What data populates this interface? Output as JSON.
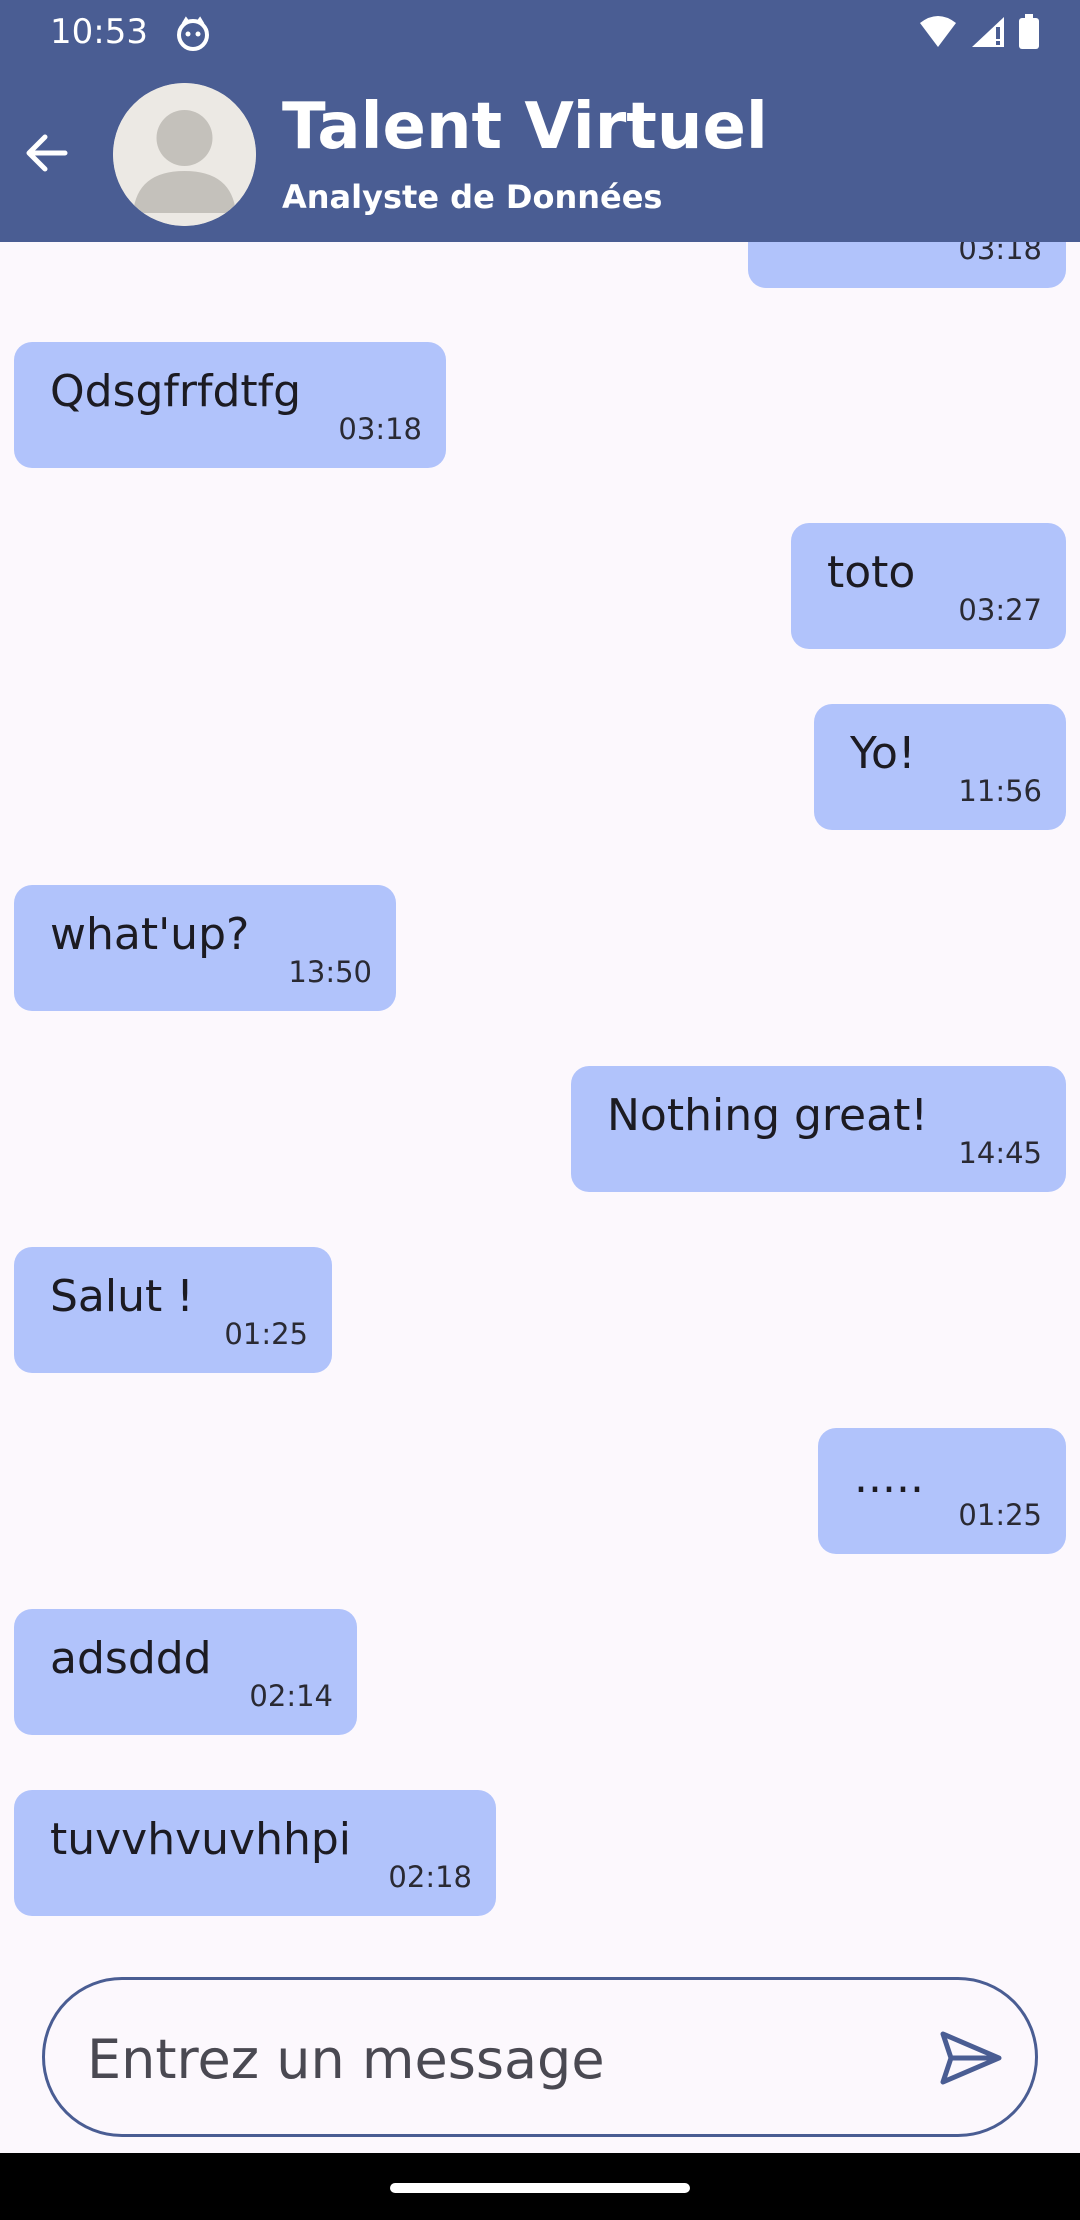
{
  "status_bar": {
    "time": "10:53"
  },
  "header": {
    "title": "Talent Virtuel",
    "subtitle": "Analyste de Données"
  },
  "messages": [
    {
      "text": "",
      "time": "03:18",
      "side": "right"
    },
    {
      "text": "Qdsgfrfdtfg",
      "time": "03:18",
      "side": "left"
    },
    {
      "text": "toto",
      "time": "03:27",
      "side": "right"
    },
    {
      "text": "Yo!",
      "time": "11:56",
      "side": "right"
    },
    {
      "text": "what'up?",
      "time": "13:50",
      "side": "left"
    },
    {
      "text": "Nothing great!",
      "time": "14:45",
      "side": "right"
    },
    {
      "text": "Salut !",
      "time": "01:25",
      "side": "left"
    },
    {
      "text": ".....",
      "time": "01:25",
      "side": "right"
    },
    {
      "text": "adsddd",
      "time": "02:14",
      "side": "left"
    },
    {
      "text": "tuvvhvuvhhpi",
      "time": "02:18",
      "side": "left"
    }
  ],
  "composer": {
    "placeholder": "Entrez un message",
    "value": ""
  },
  "colors": {
    "header_bg": "#4a5d93",
    "bubble_bg": "#b1c3fb",
    "page_bg": "#fcf8fd"
  },
  "icons": {
    "back": "arrow-back-icon",
    "send": "send-icon",
    "avatar": "person-avatar-icon"
  }
}
